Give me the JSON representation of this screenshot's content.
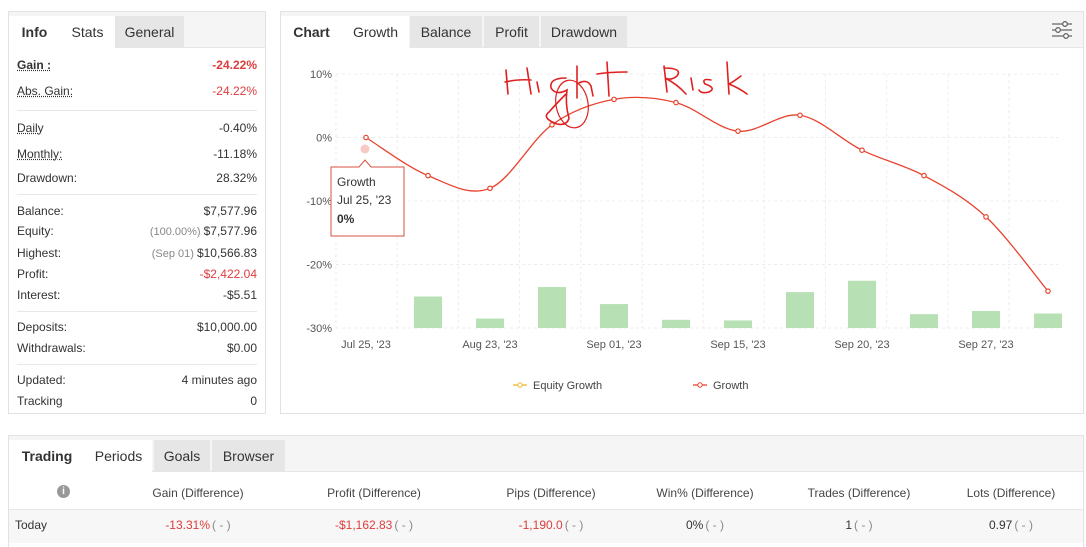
{
  "left_tabs": [
    "Info",
    "Stats",
    "General"
  ],
  "info": {
    "gain_label": "Gain :",
    "gain_value": "-24.22%",
    "abs_gain_label": "Abs. Gain:",
    "abs_gain_value": "-24.22%",
    "daily_label": "Daily",
    "daily_value": "-0.40%",
    "monthly_label": "Monthly:",
    "monthly_value": "-11.18%",
    "drawdown_label": "Drawdown:",
    "drawdown_value": "28.32%",
    "balance_label": "Balance:",
    "balance_value": "$7,577.96",
    "equity_label": "Equity:",
    "equity_sub": "(100.00%)",
    "equity_value": "$7,577.96",
    "highest_label": "Highest:",
    "highest_sub": "(Sep 01)",
    "highest_value": "$10,566.83",
    "profit_label": "Profit:",
    "profit_value": "-$2,422.04",
    "interest_label": "Interest:",
    "interest_value": "-$5.51",
    "deposits_label": "Deposits:",
    "deposits_value": "$10,000.00",
    "withdrawals_label": "Withdrawals:",
    "withdrawals_value": "$0.00",
    "updated_label": "Updated:",
    "updated_value": "4 minutes ago",
    "tracking_label": "Tracking",
    "tracking_value": "0"
  },
  "chart_tabs": [
    "Chart",
    "Growth",
    "Balance",
    "Profit",
    "Drawdown"
  ],
  "annotation": "Hight Risk",
  "tooltip": {
    "title": "Growth",
    "date": "Jul 25, '23",
    "value": "0%"
  },
  "chart_data": {
    "type": "line",
    "y_ticks": [
      "10%",
      "0%",
      "-10%",
      "-20%",
      "-30%"
    ],
    "ylim": [
      -30,
      10
    ],
    "x_tick_labels": [
      "Jul 25, '23",
      "Aug 23, '23",
      "Sep 01, '23",
      "Sep 15, '23",
      "Sep 20, '23",
      "Sep 27, '23"
    ],
    "legend": [
      "Equity Growth",
      "Growth"
    ],
    "growth": [
      0,
      -6,
      -8,
      2,
      6,
      5.5,
      1,
      3.5,
      -2,
      -6,
      -12.5,
      -24.2
    ],
    "bars": [
      5,
      1.5,
      6.5,
      3.8,
      1.3,
      1.2,
      5.7,
      7.5,
      2.2,
      2.7,
      2.3
    ],
    "colors": {
      "growth": "#e8432e",
      "equity": "#f0b429",
      "bars": "#b7e0b5"
    }
  },
  "bottom_tabs": [
    "Trading",
    "Periods",
    "Goals",
    "Browser"
  ],
  "periods": {
    "info_icon": "i",
    "headers": [
      "Gain (Difference)",
      "Profit (Difference)",
      "Pips (Difference)",
      "Win% (Difference)",
      "Trades (Difference)",
      "Lots (Difference)"
    ],
    "row": {
      "label": "Today",
      "gain": "-13.31%",
      "gain_diff": "( - )",
      "profit": "-$1,162.83",
      "profit_diff": "( - )",
      "pips": "-1,190.0",
      "pips_diff": "( - )",
      "win": "0%",
      "win_diff": "( - )",
      "trades": "1",
      "trades_diff": "( - )",
      "lots": "0.97",
      "lots_diff": "( - )"
    }
  }
}
